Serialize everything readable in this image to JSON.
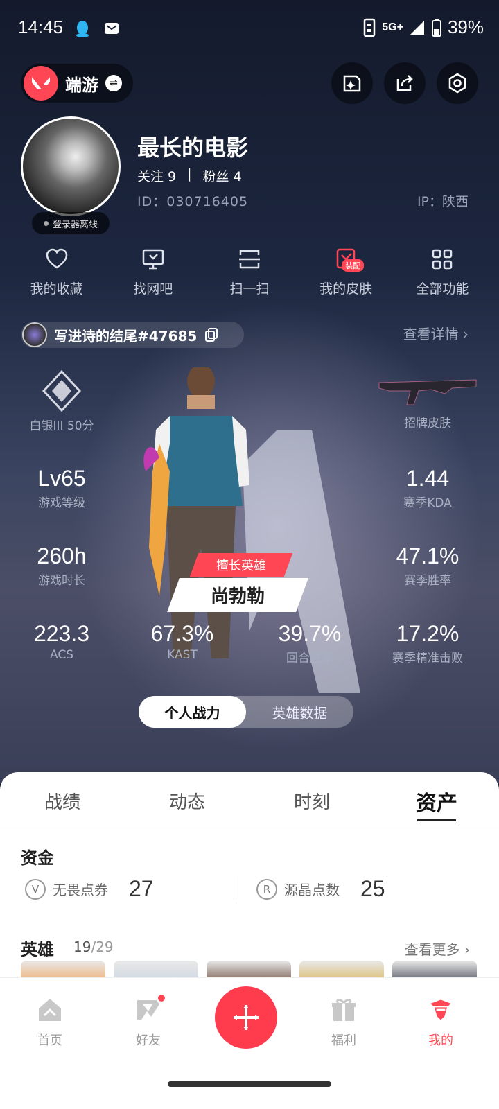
{
  "status_bar": {
    "time": "14:45",
    "network": "5G+",
    "battery": "39%"
  },
  "top_bar": {
    "app_name": "端游"
  },
  "profile": {
    "nickname": "最长的电影",
    "follow_label": "关注 9",
    "separator": "|",
    "fans_label": "粉丝 4",
    "id_text": "ID：030716405",
    "ip_text": "IP：陕西",
    "status_pill": "登录器离线"
  },
  "functions": [
    {
      "label": "我的收藏",
      "icon": "heart-icon"
    },
    {
      "label": "找网吧",
      "icon": "monitor-icon"
    },
    {
      "label": "扫一扫",
      "icon": "scan-icon"
    },
    {
      "label": "我的皮肤",
      "icon": "skin-icon",
      "badge": "装配"
    },
    {
      "label": "全部功能",
      "icon": "grid-icon"
    }
  ],
  "game_account": {
    "tag": "写进诗的结尾#47685",
    "details_link": "查看详情"
  },
  "stats": {
    "rank": {
      "label": "白银III 50分"
    },
    "skin": {
      "label": "招牌皮肤"
    },
    "level": {
      "value": "Lv65",
      "label": "游戏等级"
    },
    "kda": {
      "value": "1.44",
      "label": "赛季KDA"
    },
    "playtime": {
      "value": "260h",
      "label": "游戏时长"
    },
    "winrate": {
      "value": "47.1%",
      "label": "赛季胜率"
    },
    "acs": {
      "value": "223.3",
      "label": "ACS"
    },
    "kast": {
      "value": "67.3%",
      "label": "KAST"
    },
    "round_winrate": {
      "value": "39.7%",
      "label": "回合胜率"
    },
    "headshot": {
      "value": "17.2%",
      "label": "赛季精准击败"
    }
  },
  "best_hero": {
    "label": "擅长英雄",
    "name": "尚勃勒"
  },
  "segment": {
    "personal": "个人战力",
    "hero_data": "英雄数据"
  },
  "tabs": [
    "战绩",
    "动态",
    "时刻",
    "资产"
  ],
  "funds": {
    "title": "资金",
    "vp_label": "无畏点券",
    "vp_value": "27",
    "rp_label": "源晶点数",
    "rp_value": "25"
  },
  "heroes": {
    "title": "英雄",
    "count": "19",
    "total": "/29",
    "more": "查看更多"
  },
  "bottom_nav": {
    "home": "首页",
    "friends": "好友",
    "welfare": "福利",
    "mine": "我的"
  },
  "colors": {
    "accent": "#ff4655",
    "bg_dark": "#1b2236"
  }
}
